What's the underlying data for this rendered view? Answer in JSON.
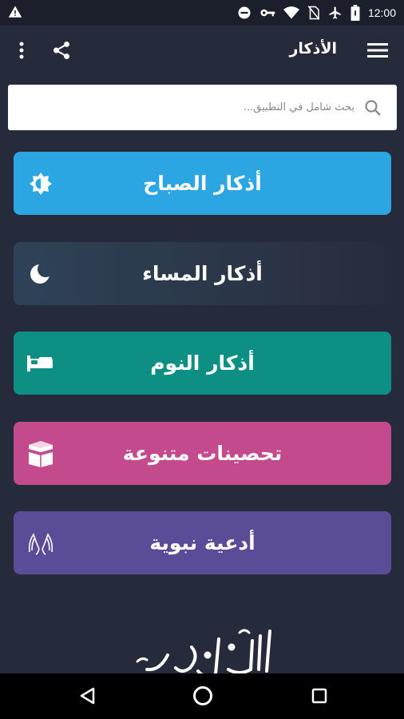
{
  "status_bar": {
    "time": "12:00",
    "icons": [
      "warning-icon",
      "dnd-icon",
      "key-icon",
      "wifi-icon",
      "no-sim-icon",
      "airplane-icon",
      "battery-icon"
    ]
  },
  "app_bar": {
    "title": "الأذكار",
    "icons": [
      "menu-icon",
      "share-icon",
      "more-vert-icon"
    ]
  },
  "search": {
    "placeholder": "بحث شامل في التطبيق...",
    "value": ""
  },
  "categories": [
    {
      "label": "أذكار الصباح",
      "icon": "sun-icon",
      "color": "#2ba6e3"
    },
    {
      "label": "أذكار المساء",
      "icon": "moon-icon",
      "color": "#2e4257"
    },
    {
      "label": "أذكار النوم",
      "icon": "bed-icon",
      "color": "#0e8f84"
    },
    {
      "label": "تحصينات متنوعة",
      "icon": "kaaba-icon",
      "color": "#c24a8d"
    },
    {
      "label": "أدعية نبوية",
      "icon": "praying-hands-icon",
      "color": "#5b4c98"
    }
  ],
  "colors": {
    "background": "#262b3b",
    "status_bar": "#1b1f2b",
    "nav_bar": "#000000"
  },
  "nav_bar": {
    "icons": [
      "back-icon",
      "home-icon",
      "recents-icon"
    ]
  }
}
